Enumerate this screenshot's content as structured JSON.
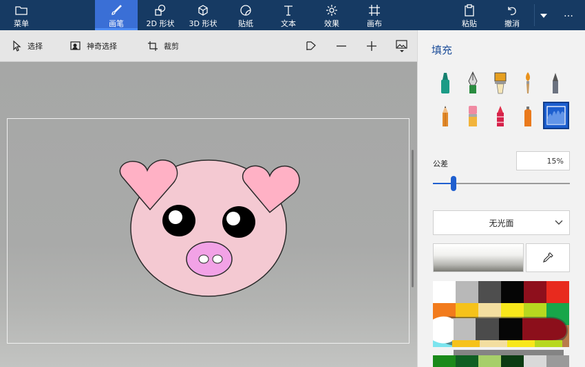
{
  "ribbon": {
    "menu_label": "菜单",
    "tabs": [
      {
        "label": "画笔",
        "icon": "brush-icon",
        "active": true
      },
      {
        "label": "2D 形状",
        "icon": "shapes-2d-icon",
        "active": false
      },
      {
        "label": "3D 形状",
        "icon": "cube-3d-icon",
        "active": false
      },
      {
        "label": "贴纸",
        "icon": "sticker-icon",
        "active": false
      },
      {
        "label": "文本",
        "icon": "text-icon",
        "active": false
      },
      {
        "label": "效果",
        "icon": "effects-icon",
        "active": false
      },
      {
        "label": "画布",
        "icon": "canvas-icon",
        "active": false
      }
    ],
    "paste_label": "粘贴",
    "undo_label": "撤消",
    "more_label": "…",
    "colors": {
      "background": "#163a63",
      "active_tab": "#3a6fd6"
    }
  },
  "toolbar": {
    "select_label": "选择",
    "magic_select_label": "神奇选择",
    "crop_label": "裁剪"
  },
  "panel": {
    "title": "填充",
    "brushes": [
      {
        "name": "marker-icon",
        "selected": false
      },
      {
        "name": "calligraphy-pen-icon",
        "selected": false
      },
      {
        "name": "oil-brush-icon",
        "selected": false
      },
      {
        "name": "watercolor-icon",
        "selected": false
      },
      {
        "name": "pixel-pen-icon",
        "selected": false
      },
      {
        "name": "pencil-icon",
        "selected": false
      },
      {
        "name": "eraser-icon",
        "selected": false
      },
      {
        "name": "crayon-icon",
        "selected": false
      },
      {
        "name": "spray-can-icon",
        "selected": false
      },
      {
        "name": "fill-bucket-icon",
        "selected": true
      }
    ],
    "tolerance_label": "公差",
    "tolerance_value": "15%",
    "tolerance_level": 0.15,
    "finish_label": "无光面",
    "colors": {
      "accent": "#1f5fcf",
      "title": "#1f4f9a"
    }
  }
}
